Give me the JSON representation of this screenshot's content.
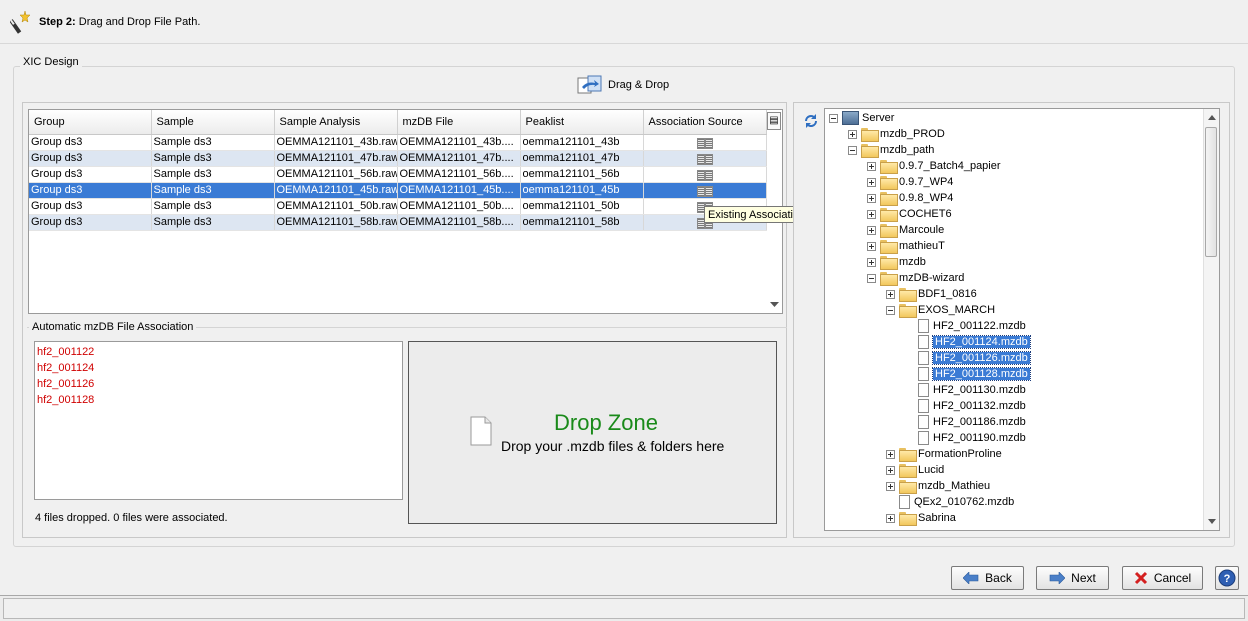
{
  "header": {
    "step_prefix": "Step 2:",
    "step_text": " Drag and Drop File Path."
  },
  "xic_design": {
    "title": "XIC Design",
    "drag_drop_label": "Drag & Drop"
  },
  "table": {
    "columns": [
      "Group",
      "Sample",
      "Sample Analysis",
      "mzDB File",
      "Peaklist",
      "Association Source"
    ],
    "rows": [
      [
        "Group ds3",
        "Sample ds3",
        "OEMMA121101_43b.raw",
        "OEMMA121101_43b....",
        "oemma121101_43b"
      ],
      [
        "Group ds3",
        "Sample ds3",
        "OEMMA121101_47b.raw",
        "OEMMA121101_47b....",
        "oemma121101_47b"
      ],
      [
        "Group ds3",
        "Sample ds3",
        "OEMMA121101_56b.raw",
        "OEMMA121101_56b....",
        "oemma121101_56b"
      ],
      [
        "Group ds3",
        "Sample ds3",
        "OEMMA121101_45b.raw",
        "OEMMA121101_45b....",
        "oemma121101_45b"
      ],
      [
        "Group ds3",
        "Sample ds3",
        "OEMMA121101_50b.raw",
        "OEMMA121101_50b....",
        "oemma121101_50b"
      ],
      [
        "Group ds3",
        "Sample ds3",
        "OEMMA121101_58b.raw",
        "OEMMA121101_58b....",
        "oemma121101_58b"
      ]
    ],
    "tooltip": "Existing Association in Database"
  },
  "auto_association": {
    "title": "Automatic mzDB File Association",
    "files": [
      "hf2_001122",
      "hf2_001124",
      "hf2_001126",
      "hf2_001128"
    ],
    "status": "4 files dropped. 0 files were associated."
  },
  "drop_zone": {
    "title": "Drop Zone",
    "hint": "Drop your .mzdb files & folders here"
  },
  "tree": {
    "nodes": [
      {
        "label": "Server",
        "type": "server",
        "level": 0,
        "expander": "minus"
      },
      {
        "label": "mzdb_PROD",
        "type": "folder",
        "level": 1,
        "expander": "plus"
      },
      {
        "label": "mzdb_path",
        "type": "folder",
        "level": 1,
        "expander": "minus"
      },
      {
        "label": "0.9.7_Batch4_papier",
        "type": "folder",
        "level": 2,
        "expander": "plus"
      },
      {
        "label": "0.9.7_WP4",
        "type": "folder",
        "level": 2,
        "expander": "plus"
      },
      {
        "label": "0.9.8_WP4",
        "type": "folder",
        "level": 2,
        "expander": "plus"
      },
      {
        "label": "COCHET6",
        "type": "folder",
        "level": 2,
        "expander": "plus"
      },
      {
        "label": "Marcoule",
        "type": "folder",
        "level": 2,
        "expander": "plus"
      },
      {
        "label": "mathieuT",
        "type": "folder",
        "level": 2,
        "expander": "plus"
      },
      {
        "label": "mzdb",
        "type": "folder",
        "level": 2,
        "expander": "plus"
      },
      {
        "label": "mzDB-wizard",
        "type": "folder",
        "level": 2,
        "expander": "minus"
      },
      {
        "label": "BDF1_0816",
        "type": "folder",
        "level": 3,
        "expander": "plus"
      },
      {
        "label": "EXOS_MARCH",
        "type": "folder",
        "level": 3,
        "expander": "minus"
      },
      {
        "label": "HF2_001122.mzdb",
        "type": "file",
        "level": 4,
        "selected": false
      },
      {
        "label": "HF2_001124.mzdb",
        "type": "file",
        "level": 4,
        "selected": true
      },
      {
        "label": "HF2_001126.mzdb",
        "type": "file",
        "level": 4,
        "selected": true
      },
      {
        "label": "HF2_001128.mzdb",
        "type": "file",
        "level": 4,
        "selected": true
      },
      {
        "label": "HF2_001130.mzdb",
        "type": "file",
        "level": 4,
        "selected": false
      },
      {
        "label": "HF2_001132.mzdb",
        "type": "file",
        "level": 4,
        "selected": false
      },
      {
        "label": "HF2_001186.mzdb",
        "type": "file",
        "level": 4,
        "selected": false
      },
      {
        "label": "HF2_001190.mzdb",
        "type": "file",
        "level": 4,
        "selected": false
      },
      {
        "label": "FormationProline",
        "type": "folder",
        "level": 3,
        "expander": "plus"
      },
      {
        "label": "Lucid",
        "type": "folder",
        "level": 3,
        "expander": "plus"
      },
      {
        "label": "mzdb_Mathieu",
        "type": "folder",
        "level": 3,
        "expander": "plus"
      },
      {
        "label": "QEx2_010762.mzdb",
        "type": "file",
        "level": 3,
        "selected": false
      },
      {
        "label": "Sabrina",
        "type": "folder",
        "level": 3,
        "expander": "plus"
      }
    ]
  },
  "buttons": {
    "back": "Back",
    "next": "Next",
    "cancel": "Cancel",
    "help": "?"
  },
  "colors": {
    "selection": "#3a7bd5",
    "alt_row": "#dde6f2",
    "drop_title": "#1a8a1a",
    "dropped_file": "#d00000"
  }
}
